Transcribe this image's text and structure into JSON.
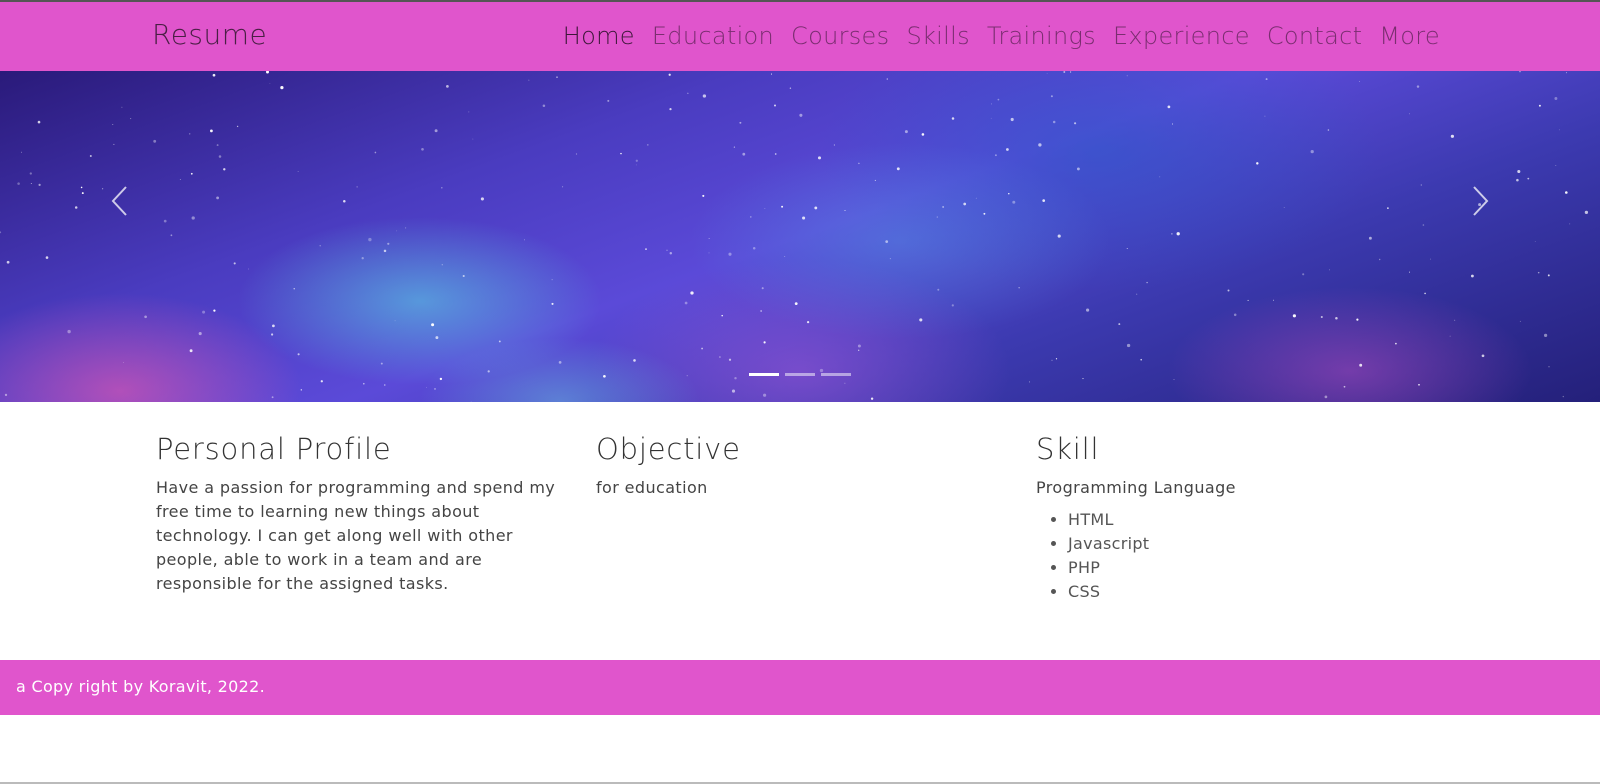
{
  "navbar": {
    "brand": "Resume",
    "items": [
      {
        "label": "Home",
        "active": true
      },
      {
        "label": "Education"
      },
      {
        "label": "Courses"
      },
      {
        "label": "Skills"
      },
      {
        "label": "Trainings"
      },
      {
        "label": "Experience"
      },
      {
        "label": "Contact"
      },
      {
        "label": "More"
      }
    ],
    "color": "#e055cc"
  },
  "carousel": {
    "prev_icon": "chevron-left-icon",
    "next_icon": "chevron-right-icon",
    "slide_count": 3,
    "active_index": 0
  },
  "profile": {
    "title": "Personal Profile",
    "text": "Have a passion for programming and spend my free time to learning new things about technology. I can get along well with other people, able to work in a team and are responsible for the assigned tasks."
  },
  "objective": {
    "title": "Objective",
    "text": "for education"
  },
  "skill": {
    "title": "Skill",
    "subtitle": "Programming Language",
    "items": [
      "HTML",
      "Javascript",
      "PHP",
      "CSS"
    ]
  },
  "footer": {
    "text": "a Copy right by Koravit, 2022."
  }
}
